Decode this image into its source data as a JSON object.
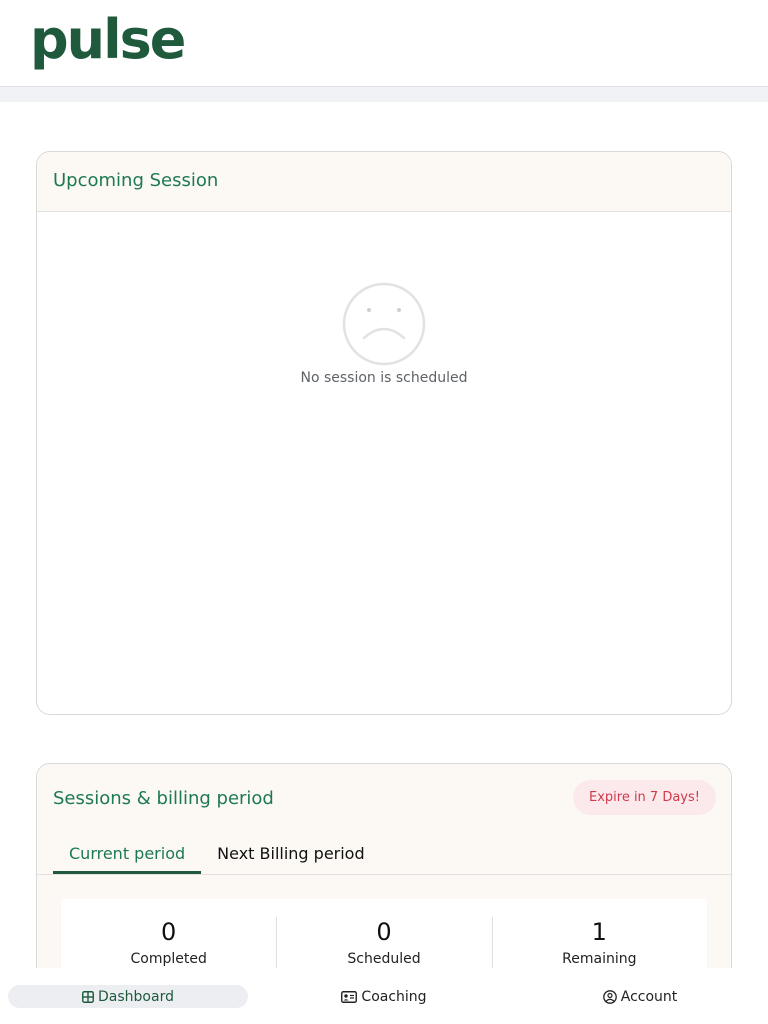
{
  "app": {
    "logo_text": "pulse",
    "brand_color": "#1f5a3c",
    "accent_color": "#1d7a4f"
  },
  "upcoming": {
    "title": "Upcoming Session",
    "empty_icon": "sad-face-icon",
    "empty_text": "No session is scheduled"
  },
  "billing": {
    "title": "Sessions & billing period",
    "badge": "Expire in 7 Days!",
    "badge_color": "#d03a4b",
    "tabs": [
      {
        "label": "Current period",
        "active": true
      },
      {
        "label": "Next Billing period",
        "active": false
      }
    ],
    "stats": [
      {
        "value": "0",
        "label": "Completed"
      },
      {
        "value": "0",
        "label": "Scheduled"
      },
      {
        "value": "1",
        "label": "Remaining"
      }
    ]
  },
  "nav": {
    "items": [
      {
        "label": "Dashboard",
        "icon": "grid-icon",
        "active": true
      },
      {
        "label": "Coaching",
        "icon": "id-card-icon",
        "active": false
      },
      {
        "label": "Account",
        "icon": "user-circle-icon",
        "active": false
      }
    ]
  }
}
